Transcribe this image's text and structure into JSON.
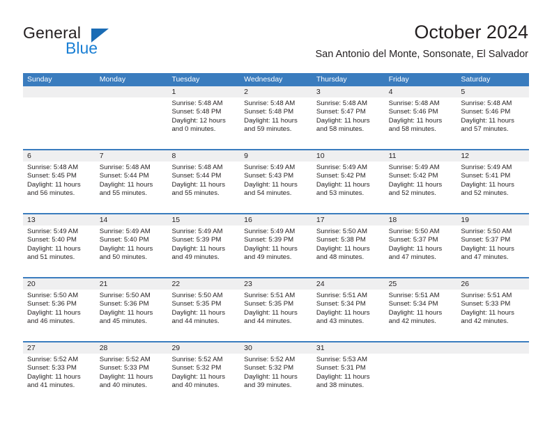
{
  "logo": {
    "word_top": "General",
    "word_bottom": "Blue",
    "triangle_color": "#1a6cb5",
    "blue_text_color": "#1a7fd4"
  },
  "header": {
    "title": "October 2024",
    "subtitle": "San Antonio del Monte, Sonsonate, El Salvador"
  },
  "theme": {
    "header_blue": "#3a7cbe",
    "band_gray": "#efeff0",
    "text": "#231f20"
  },
  "weekdays": [
    "Sunday",
    "Monday",
    "Tuesday",
    "Wednesday",
    "Thursday",
    "Friday",
    "Saturday"
  ],
  "weeks": [
    {
      "days": [
        {
          "number": "",
          "lines": [
            "",
            "",
            "",
            ""
          ]
        },
        {
          "number": "",
          "lines": [
            "",
            "",
            "",
            ""
          ]
        },
        {
          "number": "1",
          "lines": [
            "Sunrise: 5:48 AM",
            "Sunset: 5:48 PM",
            "Daylight: 12 hours",
            "and 0 minutes."
          ]
        },
        {
          "number": "2",
          "lines": [
            "Sunrise: 5:48 AM",
            "Sunset: 5:48 PM",
            "Daylight: 11 hours",
            "and 59 minutes."
          ]
        },
        {
          "number": "3",
          "lines": [
            "Sunrise: 5:48 AM",
            "Sunset: 5:47 PM",
            "Daylight: 11 hours",
            "and 58 minutes."
          ]
        },
        {
          "number": "4",
          "lines": [
            "Sunrise: 5:48 AM",
            "Sunset: 5:46 PM",
            "Daylight: 11 hours",
            "and 58 minutes."
          ]
        },
        {
          "number": "5",
          "lines": [
            "Sunrise: 5:48 AM",
            "Sunset: 5:46 PM",
            "Daylight: 11 hours",
            "and 57 minutes."
          ]
        }
      ]
    },
    {
      "days": [
        {
          "number": "6",
          "lines": [
            "Sunrise: 5:48 AM",
            "Sunset: 5:45 PM",
            "Daylight: 11 hours",
            "and 56 minutes."
          ]
        },
        {
          "number": "7",
          "lines": [
            "Sunrise: 5:48 AM",
            "Sunset: 5:44 PM",
            "Daylight: 11 hours",
            "and 55 minutes."
          ]
        },
        {
          "number": "8",
          "lines": [
            "Sunrise: 5:48 AM",
            "Sunset: 5:44 PM",
            "Daylight: 11 hours",
            "and 55 minutes."
          ]
        },
        {
          "number": "9",
          "lines": [
            "Sunrise: 5:49 AM",
            "Sunset: 5:43 PM",
            "Daylight: 11 hours",
            "and 54 minutes."
          ]
        },
        {
          "number": "10",
          "lines": [
            "Sunrise: 5:49 AM",
            "Sunset: 5:42 PM",
            "Daylight: 11 hours",
            "and 53 minutes."
          ]
        },
        {
          "number": "11",
          "lines": [
            "Sunrise: 5:49 AM",
            "Sunset: 5:42 PM",
            "Daylight: 11 hours",
            "and 52 minutes."
          ]
        },
        {
          "number": "12",
          "lines": [
            "Sunrise: 5:49 AM",
            "Sunset: 5:41 PM",
            "Daylight: 11 hours",
            "and 52 minutes."
          ]
        }
      ]
    },
    {
      "days": [
        {
          "number": "13",
          "lines": [
            "Sunrise: 5:49 AM",
            "Sunset: 5:40 PM",
            "Daylight: 11 hours",
            "and 51 minutes."
          ]
        },
        {
          "number": "14",
          "lines": [
            "Sunrise: 5:49 AM",
            "Sunset: 5:40 PM",
            "Daylight: 11 hours",
            "and 50 minutes."
          ]
        },
        {
          "number": "15",
          "lines": [
            "Sunrise: 5:49 AM",
            "Sunset: 5:39 PM",
            "Daylight: 11 hours",
            "and 49 minutes."
          ]
        },
        {
          "number": "16",
          "lines": [
            "Sunrise: 5:49 AM",
            "Sunset: 5:39 PM",
            "Daylight: 11 hours",
            "and 49 minutes."
          ]
        },
        {
          "number": "17",
          "lines": [
            "Sunrise: 5:50 AM",
            "Sunset: 5:38 PM",
            "Daylight: 11 hours",
            "and 48 minutes."
          ]
        },
        {
          "number": "18",
          "lines": [
            "Sunrise: 5:50 AM",
            "Sunset: 5:37 PM",
            "Daylight: 11 hours",
            "and 47 minutes."
          ]
        },
        {
          "number": "19",
          "lines": [
            "Sunrise: 5:50 AM",
            "Sunset: 5:37 PM",
            "Daylight: 11 hours",
            "and 47 minutes."
          ]
        }
      ]
    },
    {
      "days": [
        {
          "number": "20",
          "lines": [
            "Sunrise: 5:50 AM",
            "Sunset: 5:36 PM",
            "Daylight: 11 hours",
            "and 46 minutes."
          ]
        },
        {
          "number": "21",
          "lines": [
            "Sunrise: 5:50 AM",
            "Sunset: 5:36 PM",
            "Daylight: 11 hours",
            "and 45 minutes."
          ]
        },
        {
          "number": "22",
          "lines": [
            "Sunrise: 5:50 AM",
            "Sunset: 5:35 PM",
            "Daylight: 11 hours",
            "and 44 minutes."
          ]
        },
        {
          "number": "23",
          "lines": [
            "Sunrise: 5:51 AM",
            "Sunset: 5:35 PM",
            "Daylight: 11 hours",
            "and 44 minutes."
          ]
        },
        {
          "number": "24",
          "lines": [
            "Sunrise: 5:51 AM",
            "Sunset: 5:34 PM",
            "Daylight: 11 hours",
            "and 43 minutes."
          ]
        },
        {
          "number": "25",
          "lines": [
            "Sunrise: 5:51 AM",
            "Sunset: 5:34 PM",
            "Daylight: 11 hours",
            "and 42 minutes."
          ]
        },
        {
          "number": "26",
          "lines": [
            "Sunrise: 5:51 AM",
            "Sunset: 5:33 PM",
            "Daylight: 11 hours",
            "and 42 minutes."
          ]
        }
      ]
    },
    {
      "days": [
        {
          "number": "27",
          "lines": [
            "Sunrise: 5:52 AM",
            "Sunset: 5:33 PM",
            "Daylight: 11 hours",
            "and 41 minutes."
          ]
        },
        {
          "number": "28",
          "lines": [
            "Sunrise: 5:52 AM",
            "Sunset: 5:33 PM",
            "Daylight: 11 hours",
            "and 40 minutes."
          ]
        },
        {
          "number": "29",
          "lines": [
            "Sunrise: 5:52 AM",
            "Sunset: 5:32 PM",
            "Daylight: 11 hours",
            "and 40 minutes."
          ]
        },
        {
          "number": "30",
          "lines": [
            "Sunrise: 5:52 AM",
            "Sunset: 5:32 PM",
            "Daylight: 11 hours",
            "and 39 minutes."
          ]
        },
        {
          "number": "31",
          "lines": [
            "Sunrise: 5:53 AM",
            "Sunset: 5:31 PM",
            "Daylight: 11 hours",
            "and 38 minutes."
          ]
        },
        {
          "number": "",
          "lines": [
            "",
            "",
            "",
            ""
          ]
        },
        {
          "number": "",
          "lines": [
            "",
            "",
            "",
            ""
          ]
        }
      ]
    }
  ]
}
